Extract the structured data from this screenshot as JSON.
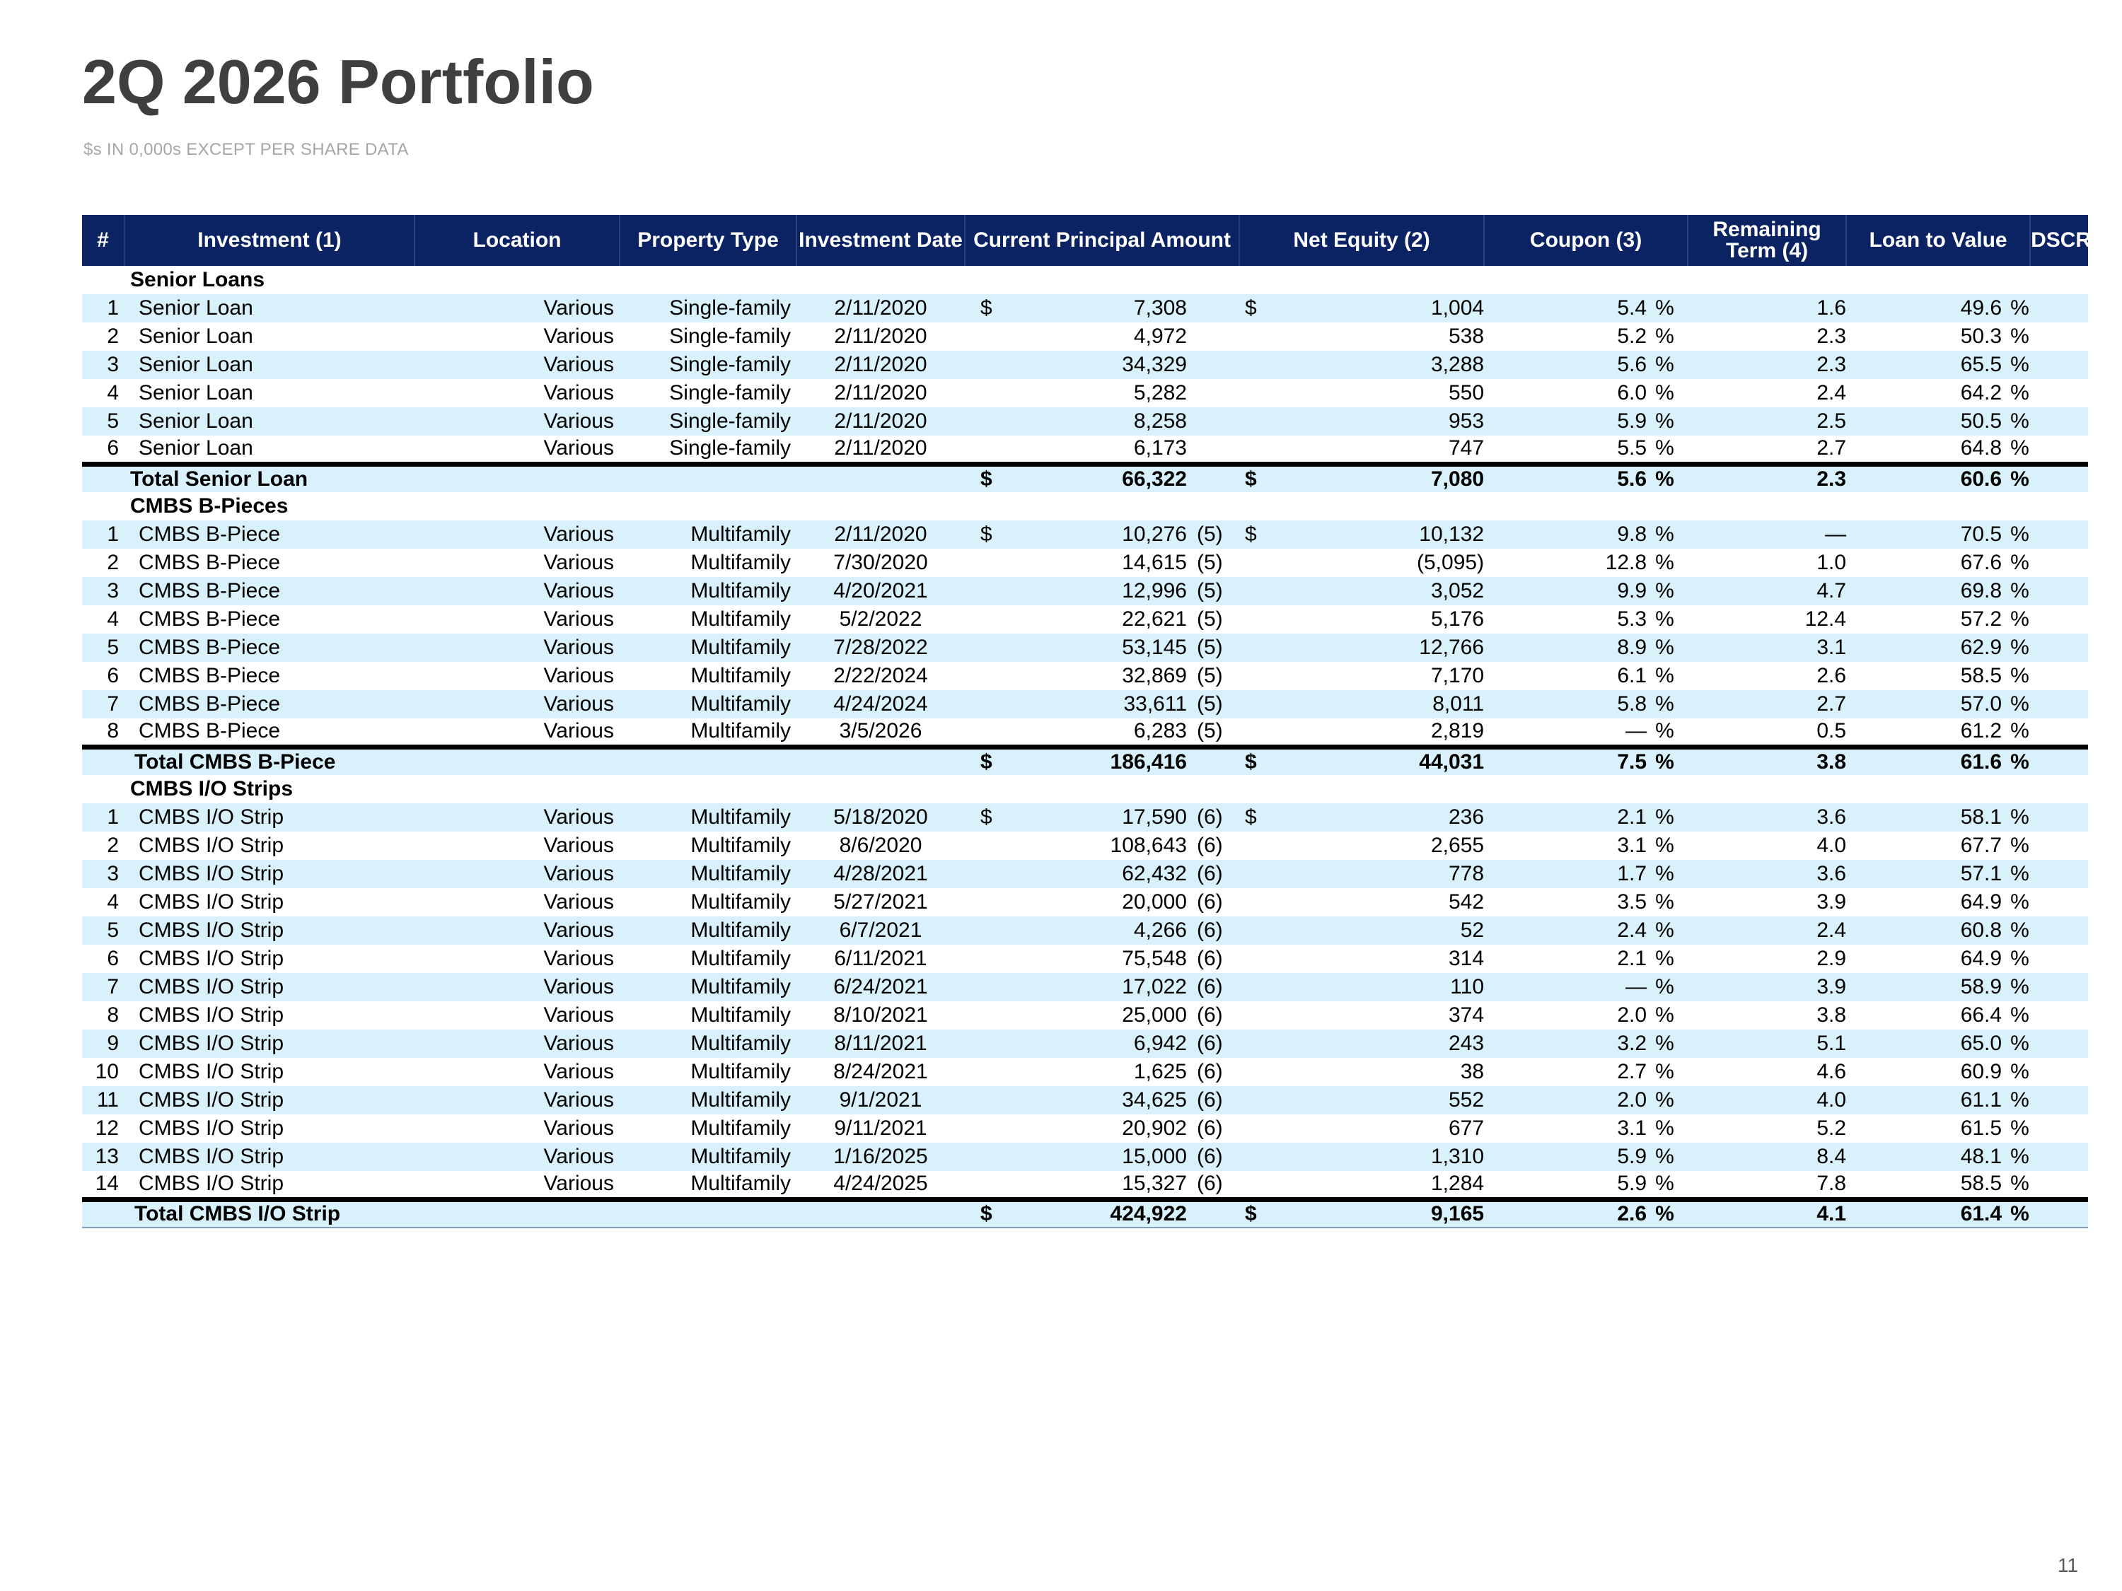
{
  "page": {
    "title": "2Q 2026 Portfolio",
    "subtitle": "$s IN 0,000s EXCEPT PER SHARE DATA",
    "page_number": "11"
  },
  "table": {
    "headers": {
      "num": "#",
      "investment": "Investment (1)",
      "location": "Location",
      "property_type": "Property Type",
      "investment_date": "Investment Date",
      "principal": "Current Principal Amount",
      "net_equity": "Net Equity (2)",
      "coupon": "Coupon (3)",
      "term": "Remaining Term (4)",
      "ltv": "Loan to Value",
      "dscr": "DSCR"
    },
    "currency_symbol": "$",
    "percent_symbol": "%",
    "sections": [
      {
        "heading": "Senior Loans",
        "rows": [
          {
            "n": "1",
            "name": "Senior Loan",
            "loc": "Various",
            "type": "Single-family",
            "date": "2/11/2020",
            "dol1": "$",
            "principal": "7,308",
            "pnote": "",
            "dol2": "$",
            "equity": "1,004",
            "coupon": "5.4",
            "term": "1.6",
            "ltv": "49.6"
          },
          {
            "n": "2",
            "name": "Senior Loan",
            "loc": "Various",
            "type": "Single-family",
            "date": "2/11/2020",
            "dol1": "",
            "principal": "4,972",
            "pnote": "",
            "dol2": "",
            "equity": "538",
            "coupon": "5.2",
            "term": "2.3",
            "ltv": "50.3"
          },
          {
            "n": "3",
            "name": "Senior Loan",
            "loc": "Various",
            "type": "Single-family",
            "date": "2/11/2020",
            "dol1": "",
            "principal": "34,329",
            "pnote": "",
            "dol2": "",
            "equity": "3,288",
            "coupon": "5.6",
            "term": "2.3",
            "ltv": "65.5"
          },
          {
            "n": "4",
            "name": "Senior Loan",
            "loc": "Various",
            "type": "Single-family",
            "date": "2/11/2020",
            "dol1": "",
            "principal": "5,282",
            "pnote": "",
            "dol2": "",
            "equity": "550",
            "coupon": "6.0",
            "term": "2.4",
            "ltv": "64.2"
          },
          {
            "n": "5",
            "name": "Senior Loan",
            "loc": "Various",
            "type": "Single-family",
            "date": "2/11/2020",
            "dol1": "",
            "principal": "8,258",
            "pnote": "",
            "dol2": "",
            "equity": "953",
            "coupon": "5.9",
            "term": "2.5",
            "ltv": "50.5"
          },
          {
            "n": "6",
            "name": "Senior Loan",
            "loc": "Various",
            "type": "Single-family",
            "date": "2/11/2020",
            "dol1": "",
            "principal": "6,173",
            "pnote": "",
            "dol2": "",
            "equity": "747",
            "coupon": "5.5",
            "term": "2.7",
            "ltv": "64.8"
          }
        ],
        "total": {
          "label": "Total Senior Loan",
          "principal": "66,322",
          "equity": "7,080",
          "coupon": "5.6",
          "term": "2.3",
          "ltv": "60.6"
        }
      },
      {
        "heading": "CMBS B-Pieces",
        "rows": [
          {
            "n": "1",
            "name": "CMBS B-Piece",
            "loc": "Various",
            "type": "Multifamily",
            "date": "2/11/2020",
            "dol1": "$",
            "principal": "10,276",
            "pnote": "(5)",
            "dol2": "$",
            "equity": "10,132",
            "coupon": "9.8",
            "term": "—",
            "ltv": "70.5"
          },
          {
            "n": "2",
            "name": "CMBS B-Piece",
            "loc": "Various",
            "type": "Multifamily",
            "date": "7/30/2020",
            "dol1": "",
            "principal": "14,615",
            "pnote": "(5)",
            "dol2": "",
            "equity": "(5,095)",
            "coupon": "12.8",
            "term": "1.0",
            "ltv": "67.6"
          },
          {
            "n": "3",
            "name": "CMBS B-Piece",
            "loc": "Various",
            "type": "Multifamily",
            "date": "4/20/2021",
            "dol1": "",
            "principal": "12,996",
            "pnote": "(5)",
            "dol2": "",
            "equity": "3,052",
            "coupon": "9.9",
            "term": "4.7",
            "ltv": "69.8"
          },
          {
            "n": "4",
            "name": "CMBS B-Piece",
            "loc": "Various",
            "type": "Multifamily",
            "date": "5/2/2022",
            "dol1": "",
            "principal": "22,621",
            "pnote": "(5)",
            "dol2": "",
            "equity": "5,176",
            "coupon": "5.3",
            "term": "12.4",
            "ltv": "57.2"
          },
          {
            "n": "5",
            "name": "CMBS B-Piece",
            "loc": "Various",
            "type": "Multifamily",
            "date": "7/28/2022",
            "dol1": "",
            "principal": "53,145",
            "pnote": "(5)",
            "dol2": "",
            "equity": "12,766",
            "coupon": "8.9",
            "term": "3.1",
            "ltv": "62.9"
          },
          {
            "n": "6",
            "name": "CMBS B-Piece",
            "loc": "Various",
            "type": "Multifamily",
            "date": "2/22/2024",
            "dol1": "",
            "principal": "32,869",
            "pnote": "(5)",
            "dol2": "",
            "equity": "7,170",
            "coupon": "6.1",
            "term": "2.6",
            "ltv": "58.5"
          },
          {
            "n": "7",
            "name": "CMBS B-Piece",
            "loc": "Various",
            "type": "Multifamily",
            "date": "4/24/2024",
            "dol1": "",
            "principal": "33,611",
            "pnote": "(5)",
            "dol2": "",
            "equity": "8,011",
            "coupon": "5.8",
            "term": "2.7",
            "ltv": "57.0"
          },
          {
            "n": "8",
            "name": "CMBS B-Piece",
            "loc": "Various",
            "type": "Multifamily",
            "date": "3/5/2026",
            "dol1": "",
            "principal": "6,283",
            "pnote": "(5)",
            "dol2": "",
            "equity": "2,819",
            "coupon": "—",
            "term": "0.5",
            "ltv": "61.2"
          }
        ],
        "total": {
          "label": "Total CMBS B-Piece",
          "principal": "186,416",
          "equity": "44,031",
          "coupon": "7.5",
          "term": "3.8",
          "ltv": "61.6"
        }
      },
      {
        "heading": "CMBS I/O Strips",
        "rows": [
          {
            "n": "1",
            "name": "CMBS I/O Strip",
            "loc": "Various",
            "type": "Multifamily",
            "date": "5/18/2020",
            "dol1": "$",
            "principal": "17,590",
            "pnote": "(6)",
            "dol2": "$",
            "equity": "236",
            "coupon": "2.1",
            "term": "3.6",
            "ltv": "58.1"
          },
          {
            "n": "2",
            "name": "CMBS I/O Strip",
            "loc": "Various",
            "type": "Multifamily",
            "date": "8/6/2020",
            "dol1": "",
            "principal": "108,643",
            "pnote": "(6)",
            "dol2": "",
            "equity": "2,655",
            "coupon": "3.1",
            "term": "4.0",
            "ltv": "67.7"
          },
          {
            "n": "3",
            "name": "CMBS I/O Strip",
            "loc": "Various",
            "type": "Multifamily",
            "date": "4/28/2021",
            "dol1": "",
            "principal": "62,432",
            "pnote": "(6)",
            "dol2": "",
            "equity": "778",
            "coupon": "1.7",
            "term": "3.6",
            "ltv": "57.1"
          },
          {
            "n": "4",
            "name": "CMBS I/O Strip",
            "loc": "Various",
            "type": "Multifamily",
            "date": "5/27/2021",
            "dol1": "",
            "principal": "20,000",
            "pnote": "(6)",
            "dol2": "",
            "equity": "542",
            "coupon": "3.5",
            "term": "3.9",
            "ltv": "64.9"
          },
          {
            "n": "5",
            "name": "CMBS I/O Strip",
            "loc": "Various",
            "type": "Multifamily",
            "date": "6/7/2021",
            "dol1": "",
            "principal": "4,266",
            "pnote": "(6)",
            "dol2": "",
            "equity": "52",
            "coupon": "2.4",
            "term": "2.4",
            "ltv": "60.8"
          },
          {
            "n": "6",
            "name": "CMBS I/O Strip",
            "loc": "Various",
            "type": "Multifamily",
            "date": "6/11/2021",
            "dol1": "",
            "principal": "75,548",
            "pnote": "(6)",
            "dol2": "",
            "equity": "314",
            "coupon": "2.1",
            "term": "2.9",
            "ltv": "64.9"
          },
          {
            "n": "7",
            "name": "CMBS I/O Strip",
            "loc": "Various",
            "type": "Multifamily",
            "date": "6/24/2021",
            "dol1": "",
            "principal": "17,022",
            "pnote": "(6)",
            "dol2": "",
            "equity": "110",
            "coupon": "—",
            "term": "3.9",
            "ltv": "58.9"
          },
          {
            "n": "8",
            "name": "CMBS I/O Strip",
            "loc": "Various",
            "type": "Multifamily",
            "date": "8/10/2021",
            "dol1": "",
            "principal": "25,000",
            "pnote": "(6)",
            "dol2": "",
            "equity": "374",
            "coupon": "2.0",
            "term": "3.8",
            "ltv": "66.4"
          },
          {
            "n": "9",
            "name": "CMBS I/O Strip",
            "loc": "Various",
            "type": "Multifamily",
            "date": "8/11/2021",
            "dol1": "",
            "principal": "6,942",
            "pnote": "(6)",
            "dol2": "",
            "equity": "243",
            "coupon": "3.2",
            "term": "5.1",
            "ltv": "65.0"
          },
          {
            "n": "10",
            "name": "CMBS I/O Strip",
            "loc": "Various",
            "type": "Multifamily",
            "date": "8/24/2021",
            "dol1": "",
            "principal": "1,625",
            "pnote": "(6)",
            "dol2": "",
            "equity": "38",
            "coupon": "2.7",
            "term": "4.6",
            "ltv": "60.9"
          },
          {
            "n": "11",
            "name": "CMBS I/O Strip",
            "loc": "Various",
            "type": "Multifamily",
            "date": "9/1/2021",
            "dol1": "",
            "principal": "34,625",
            "pnote": "(6)",
            "dol2": "",
            "equity": "552",
            "coupon": "2.0",
            "term": "4.0",
            "ltv": "61.1"
          },
          {
            "n": "12",
            "name": "CMBS I/O Strip",
            "loc": "Various",
            "type": "Multifamily",
            "date": "9/11/2021",
            "dol1": "",
            "principal": "20,902",
            "pnote": "(6)",
            "dol2": "",
            "equity": "677",
            "coupon": "3.1",
            "term": "5.2",
            "ltv": "61.5"
          },
          {
            "n": "13",
            "name": "CMBS I/O Strip",
            "loc": "Various",
            "type": "Multifamily",
            "date": "1/16/2025",
            "dol1": "",
            "principal": "15,000",
            "pnote": "(6)",
            "dol2": "",
            "equity": "1,310",
            "coupon": "5.9",
            "term": "8.4",
            "ltv": "48.1"
          },
          {
            "n": "14",
            "name": "CMBS I/O Strip",
            "loc": "Various",
            "type": "Multifamily",
            "date": "4/24/2025",
            "dol1": "",
            "principal": "15,327",
            "pnote": "(6)",
            "dol2": "",
            "equity": "1,284",
            "coupon": "5.9",
            "term": "7.8",
            "ltv": "58.5"
          }
        ],
        "total": {
          "label": "Total CMBS I/O Strip",
          "principal": "424,922",
          "equity": "9,165",
          "coupon": "2.6",
          "term": "4.1",
          "ltv": "61.4"
        }
      }
    ]
  }
}
